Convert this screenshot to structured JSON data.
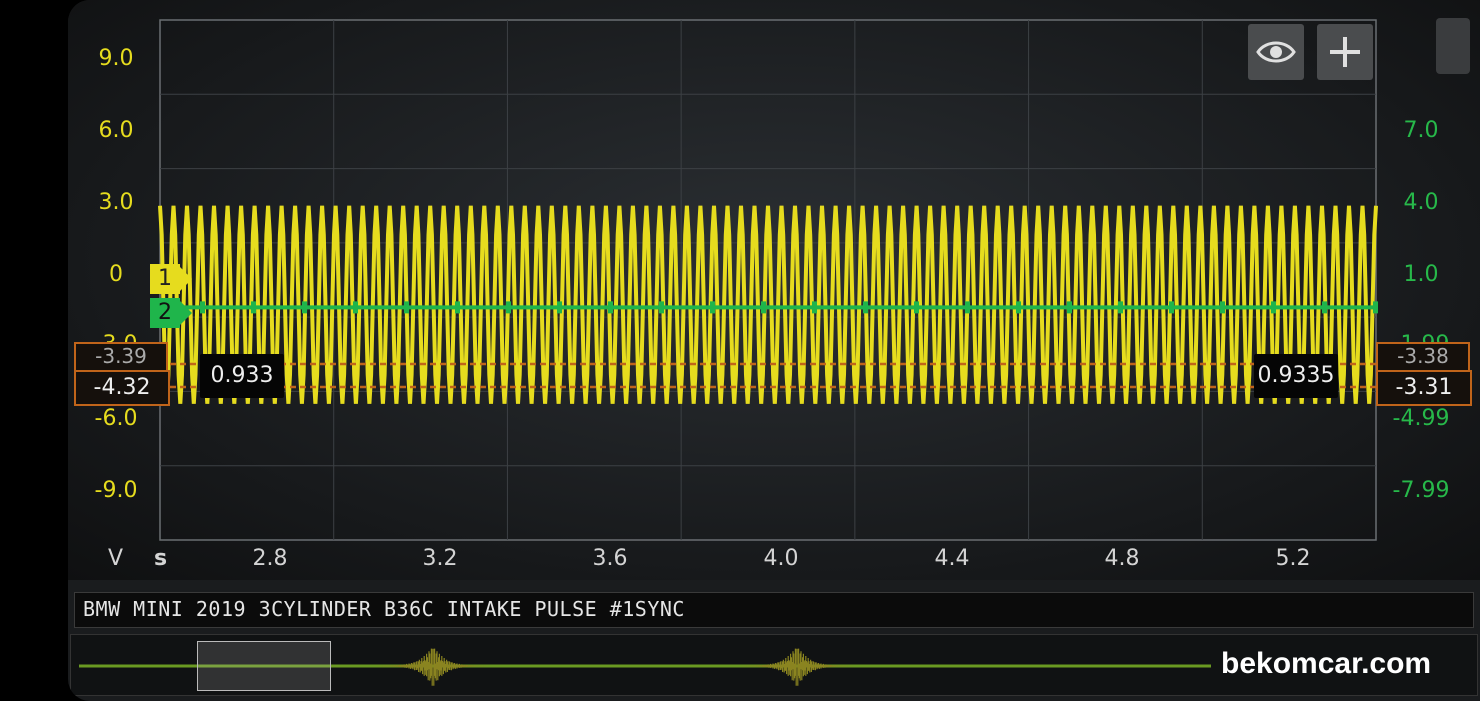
{
  "toolbar": {
    "eye_icon": "eye-icon",
    "add_icon": "plus-icon"
  },
  "left_axis": {
    "unit": "V",
    "ticks": [
      "9.0",
      "6.0",
      "3.0",
      "0",
      "-3.0",
      "-6.0",
      "-9.0"
    ],
    "color": "#e6dc1e"
  },
  "right_axis": {
    "ticks": [
      "7.0",
      "4.0",
      "1.0",
      "-1.99",
      "-4.99",
      "-7.99"
    ],
    "color": "#27b94a"
  },
  "x_axis": {
    "unit": "s",
    "ticks": [
      "2.8",
      "3.2",
      "3.6",
      "4.0",
      "4.4",
      "4.8",
      "5.2"
    ]
  },
  "channels": [
    {
      "label": "1",
      "color": "#e6dc1e"
    },
    {
      "label": "2",
      "color": "#1fb54b"
    }
  ],
  "cursors": {
    "left_a": "-3.39",
    "left_b": "-4.32",
    "right_a": "-3.38",
    "right_b": "-3.31",
    "time_left": "0.933",
    "time_right": "0.9335",
    "color": "#c0641a"
  },
  "title": "BMW MINI 2019 3CYLINDER B36C INTAKE PULSE #1SYNC",
  "watermark": "bekomcar.com",
  "chart_data": {
    "type": "line",
    "series": [
      {
        "name": "1",
        "color": "#e6dc1e",
        "waveform": "oscillation",
        "high": 3.0,
        "low": -5.0
      },
      {
        "name": "2",
        "color": "#1fb54b",
        "waveform": "flat",
        "level": -1.0
      }
    ],
    "xlim": [
      2.6,
      5.4
    ],
    "ylim": [
      -10.5,
      10.5
    ],
    "y2lim": [
      -9.5,
      9.5
    ],
    "xlabel": "s",
    "ylabel": "V",
    "grid": true
  }
}
